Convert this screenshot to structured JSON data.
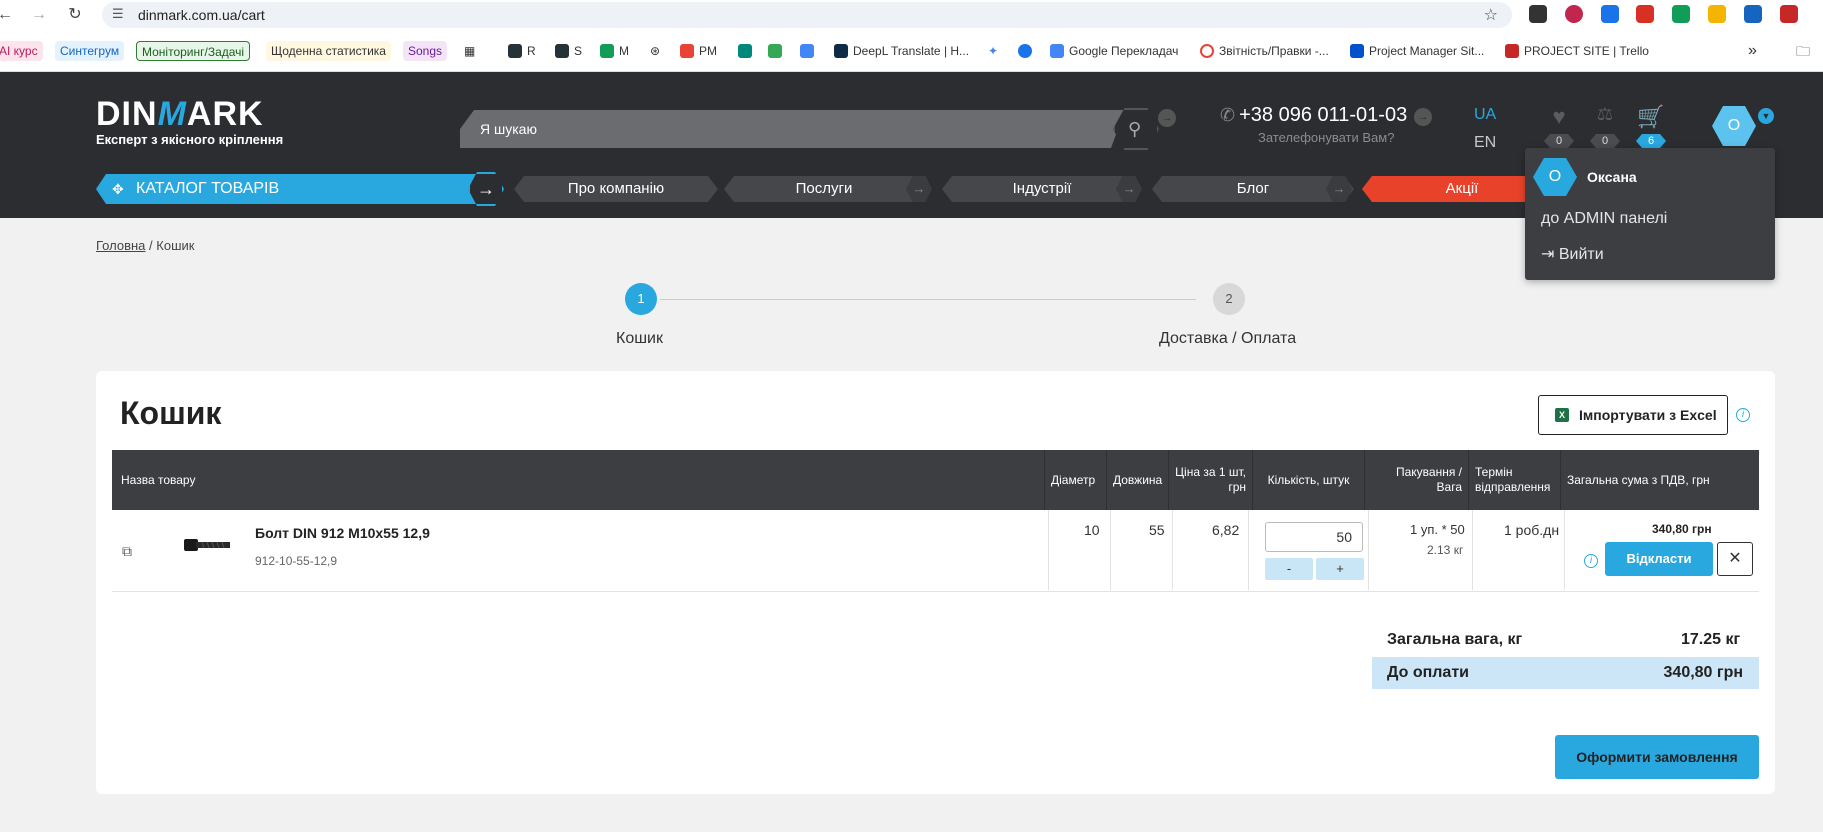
{
  "browser": {
    "url": "dinmark.com.ua/cart",
    "bookmarks": [
      "AI курс",
      "Синтегрум",
      "Моніторинг/Задачі",
      "Щоденна статистика",
      "Songs",
      "R",
      "S",
      "M",
      "PM",
      "DeepL Translate | H...",
      "Google Перекладач",
      "Звітність/Правки -...",
      "Project Manager Sit...",
      "PROJECT SITE | Trello"
    ]
  },
  "header": {
    "logo_prefix": "DIN",
    "logo_m": "M",
    "logo_suffix": "ARK",
    "slogan": "Експерт з якісного кріплення",
    "search_placeholder": "Я шукаю",
    "phone": "+38 096 011-01-03",
    "callback": "Зателефонувати Вам?",
    "lang_ua": "UA",
    "lang_en": "EN",
    "wishlist_count": "0",
    "compare_count": "0",
    "cart_count": "6",
    "avatar_letter": "О"
  },
  "nav": {
    "catalog": "КАТАЛОГ ТОВАРІВ",
    "items": [
      "Про компанію",
      "Послуги",
      "Індустрії",
      "Блог",
      "Акції"
    ]
  },
  "user_menu": {
    "avatar_letter": "О",
    "name": "Оксана",
    "admin": "до ADMIN панелі",
    "logout": "Вийти"
  },
  "breadcrumb": {
    "home": "Головна",
    "sep": "/",
    "current": "Кошик"
  },
  "steps": [
    {
      "num": "1",
      "label": "Кошик"
    },
    {
      "num": "2",
      "label": "Доставка / Оплата"
    }
  ],
  "cart": {
    "title": "Кошик",
    "import_label": "Імпортувати з Excel",
    "columns": [
      "Назва товару",
      "Діаметр",
      "Довжина",
      "Ціна за 1 шт, грн",
      "Кількість, штук",
      "Пакування / Вага",
      "Термін відправлення",
      "Загальна сума з ПДВ, грн"
    ],
    "items": [
      {
        "name": "Болт DIN 912 M10x55 12,9",
        "sku": "912-10-55-12,9",
        "diameter": "10",
        "length": "55",
        "price": "6,82",
        "qty": "50",
        "minus": "-",
        "plus": "+",
        "pack": "1 уп. * 50",
        "weight": "2.13 кг",
        "term": "1 роб.дн",
        "sum": "340,80 грн",
        "postpone_label": "Відкласти",
        "remove_label": "✕"
      }
    ],
    "total_weight_label": "Загальна вага, кг",
    "total_weight_value": "17.25 кг",
    "topay_label": "До оплати",
    "topay_value": "340,80 грн",
    "order_button": "Оформити замовлення"
  }
}
